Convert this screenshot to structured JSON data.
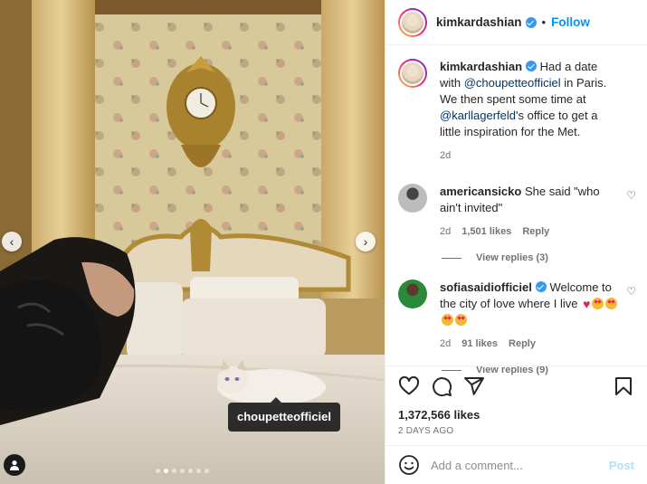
{
  "post": {
    "author": "kimkardashian",
    "follow_label": "Follow",
    "separator": "•",
    "caption_parts": [
      "Had a date with ",
      "@choupetteofficiel",
      " in Paris. We then spent some time at ",
      "@karllagerfeld",
      "'s office to get a little inspiration for the Met."
    ],
    "caption_time": "2d",
    "image_tag": "choupetteofficiel",
    "carousel": {
      "count": 7,
      "active_index": 1
    },
    "nav_prev": "‹",
    "nav_next": "›"
  },
  "comments": [
    {
      "username": "americansicko",
      "text": "She said \"who ain't invited\"",
      "time": "2d",
      "likes": "1,501 likes",
      "reply": "Reply",
      "view_replies": "View replies (3)"
    },
    {
      "username": "sofiasaidiofficiel",
      "text": "Welcome to the city of love where I live",
      "time": "2d",
      "likes": "91 likes",
      "reply": "Reply",
      "view_replies": "View replies (9)"
    }
  ],
  "footer": {
    "likes": "1,372,566 likes",
    "ago": "2 DAYS AGO",
    "add_comment_placeholder": "Add a comment...",
    "post_label": "Post"
  },
  "icons": {
    "like": "heart-icon",
    "comment": "comment-icon",
    "share": "share-icon",
    "save": "bookmark-icon",
    "emoji": "emoji-icon",
    "user_tag": "user-tag-icon"
  },
  "colors": {
    "accent": "#0095f6",
    "verified": "#3897f0",
    "post_disabled": "#b2dffc"
  }
}
